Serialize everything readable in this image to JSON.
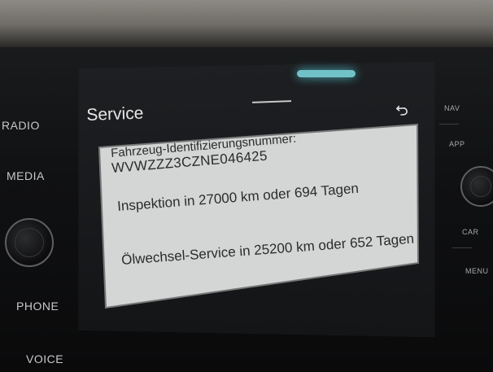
{
  "left_buttons": [
    "RADIO",
    "MEDIA",
    "PHONE",
    "VOICE"
  ],
  "right_buttons": [
    "NAV",
    "APP",
    "CAR",
    "MENU"
  ],
  "screen": {
    "title": "Service",
    "vin_label": "Fahrzeug-Identifizierungsnummer:",
    "vin": "WVWZZZ3CZNE046425",
    "inspection": "Inspektion in 27000 km oder 694 Tagen",
    "oil_service": "Ölwechsel-Service in 25200 km oder 652 Tagen"
  },
  "colors": {
    "panel": "#d4d5d5",
    "text": "#2b2b2b",
    "accent_glow": "#7fe0e6"
  },
  "icons": {
    "back": "back-arrow-icon"
  }
}
